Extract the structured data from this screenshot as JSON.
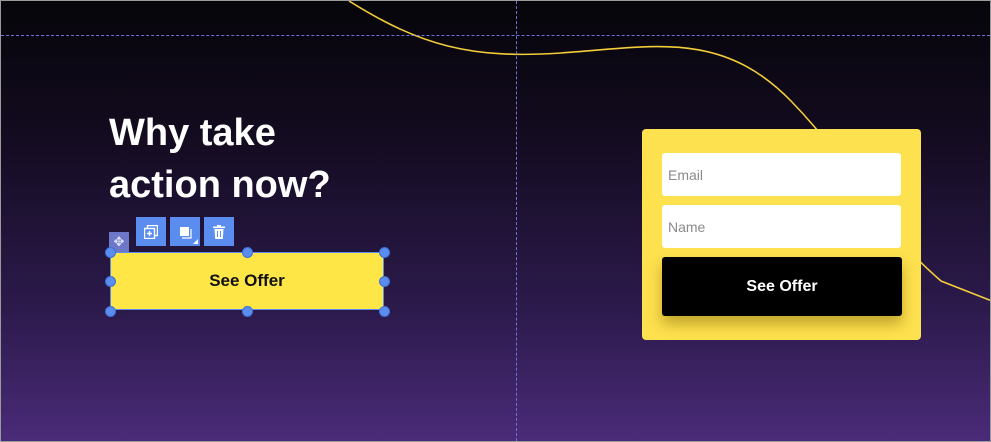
{
  "editor": {
    "headline_line1": "Why take",
    "headline_line2": "action now?",
    "selected_button_label": "See Offer",
    "toolbar": {
      "duplicate_icon": "duplicate-icon",
      "layers_icon": "layers-icon",
      "delete_icon": "trash-icon",
      "move_icon": "move-icon"
    }
  },
  "form": {
    "email_placeholder": "Email",
    "name_placeholder": "Name",
    "submit_label": "See Offer"
  },
  "colors": {
    "background_top": "#06050a",
    "background_bottom": "#4a2b78",
    "accent_yellow": "#fee647",
    "selection_blue": "#5b8def",
    "curve_yellow": "#f2cc3a"
  }
}
